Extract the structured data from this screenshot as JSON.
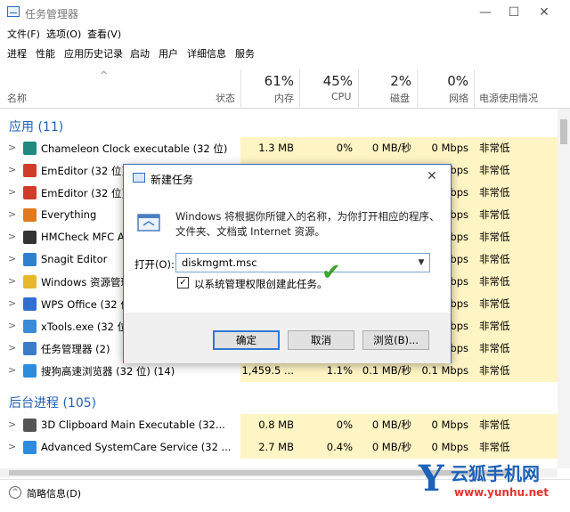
{
  "window": {
    "title": "任务管理器",
    "controls": {
      "minimize": "—",
      "maximize": "☐",
      "close": "✕"
    }
  },
  "menu": [
    "文件(F)",
    "选项(O)",
    "查看(V)"
  ],
  "tabs": [
    "进程",
    "性能",
    "应用历史记录",
    "启动",
    "用户",
    "详细信息",
    "服务"
  ],
  "columns": {
    "name": "名称",
    "status": "状态",
    "mem": {
      "pct": "61%",
      "label": "内存"
    },
    "cpu": {
      "pct": "45%",
      "label": "CPU"
    },
    "disk": {
      "pct": "2%",
      "label": "磁盘"
    },
    "net": {
      "pct": "0%",
      "label": "网络"
    },
    "power": {
      "label": "电源使用情况"
    }
  },
  "sections": {
    "apps": "应用 (11)",
    "background": "后台进程 (105)"
  },
  "apps": [
    {
      "name": "Chameleon Clock executable (32 位)",
      "mem": "1.3 MB",
      "cpu": "0%",
      "disk": "0 MB/秒",
      "net": "0 Mbps",
      "power": "非常低",
      "icon_color": "#1f8a7d"
    },
    {
      "name": "EmEditor (32 位) (2)",
      "mem": "",
      "cpu": "",
      "disk": "",
      "net": "bps",
      "power": "非常低",
      "icon_color": "#d13b2a"
    },
    {
      "name": "EmEditor (32 位)",
      "mem": "",
      "cpu": "",
      "disk": "",
      "net": "bps",
      "power": "非常低",
      "icon_color": "#d13b2a"
    },
    {
      "name": "Everything",
      "mem": "",
      "cpu": "",
      "disk": "",
      "net": "bps",
      "power": "非常低",
      "icon_color": "#e07a1c"
    },
    {
      "name": "HMCheck MFC Ap",
      "mem": "",
      "cpu": "",
      "disk": "",
      "net": "bps",
      "power": "非常低",
      "icon_color": "#333333"
    },
    {
      "name": "Snagit Editor",
      "mem": "",
      "cpu": "",
      "disk": "",
      "net": "bps",
      "power": "非常低",
      "icon_color": "#2f7fd1"
    },
    {
      "name": "Windows 资源管理",
      "mem": "",
      "cpu": "",
      "disk": "",
      "net": "bps",
      "power": "非常低",
      "icon_color": "#e8b82a"
    },
    {
      "name": "WPS Office (32 位",
      "mem": "",
      "cpu": "",
      "disk": "",
      "net": "bps",
      "power": "非常低",
      "icon_color": "#2f6fd1"
    },
    {
      "name": "xTools.exe (32 位",
      "mem": "",
      "cpu": "",
      "disk": "",
      "net": "bps",
      "power": "非常低",
      "icon_color": "#3a8ad9"
    },
    {
      "name": "任务管理器 (2)",
      "mem": "",
      "cpu": "",
      "disk": "",
      "net": "bps",
      "power": "非常低",
      "icon_color": "#3b7cc9"
    },
    {
      "name": "搜狗高速浏览器 (32 位) (14)",
      "mem": "1,459.5 ...",
      "cpu": "1.1%",
      "disk": "0.1 MB/秒",
      "net": "0.1 Mbps",
      "power": "非常低",
      "icon_color": "#2b8ce0"
    }
  ],
  "background": [
    {
      "name": "3D Clipboard Main Executable (32...",
      "mem": "0.8 MB",
      "cpu": "0%",
      "disk": "0 MB/秒",
      "net": "0 Mbps",
      "power": "非常低",
      "icon_color": "#555555"
    },
    {
      "name": "Advanced SystemCare Service (32 ...",
      "mem": "2.7 MB",
      "cpu": "0.4%",
      "disk": "0 MB/秒",
      "net": "0 Mbps",
      "power": "非常低",
      "icon_color": "#2b8ce0"
    }
  ],
  "footer": {
    "label": "简略信息(D)",
    "icon": "chevron-up-icon"
  },
  "dialog": {
    "title": "新建任务",
    "close": "✕",
    "message": "Windows 将根据你所键入的名称，为你打开相应的程序、文件夹、文档或 Internet 资源。",
    "open_label": "打开(O):",
    "input_value": "diskmgmt.msc",
    "checkbox_label": "以系统管理权限创建此任务。",
    "checkbox_checked": "✓",
    "buttons": {
      "ok": "确定",
      "cancel": "取消",
      "browse": "浏览(B)..."
    }
  },
  "watermark": {
    "letter": "Y",
    "title": "云狐手机网",
    "url": "www.yunhu.net"
  }
}
